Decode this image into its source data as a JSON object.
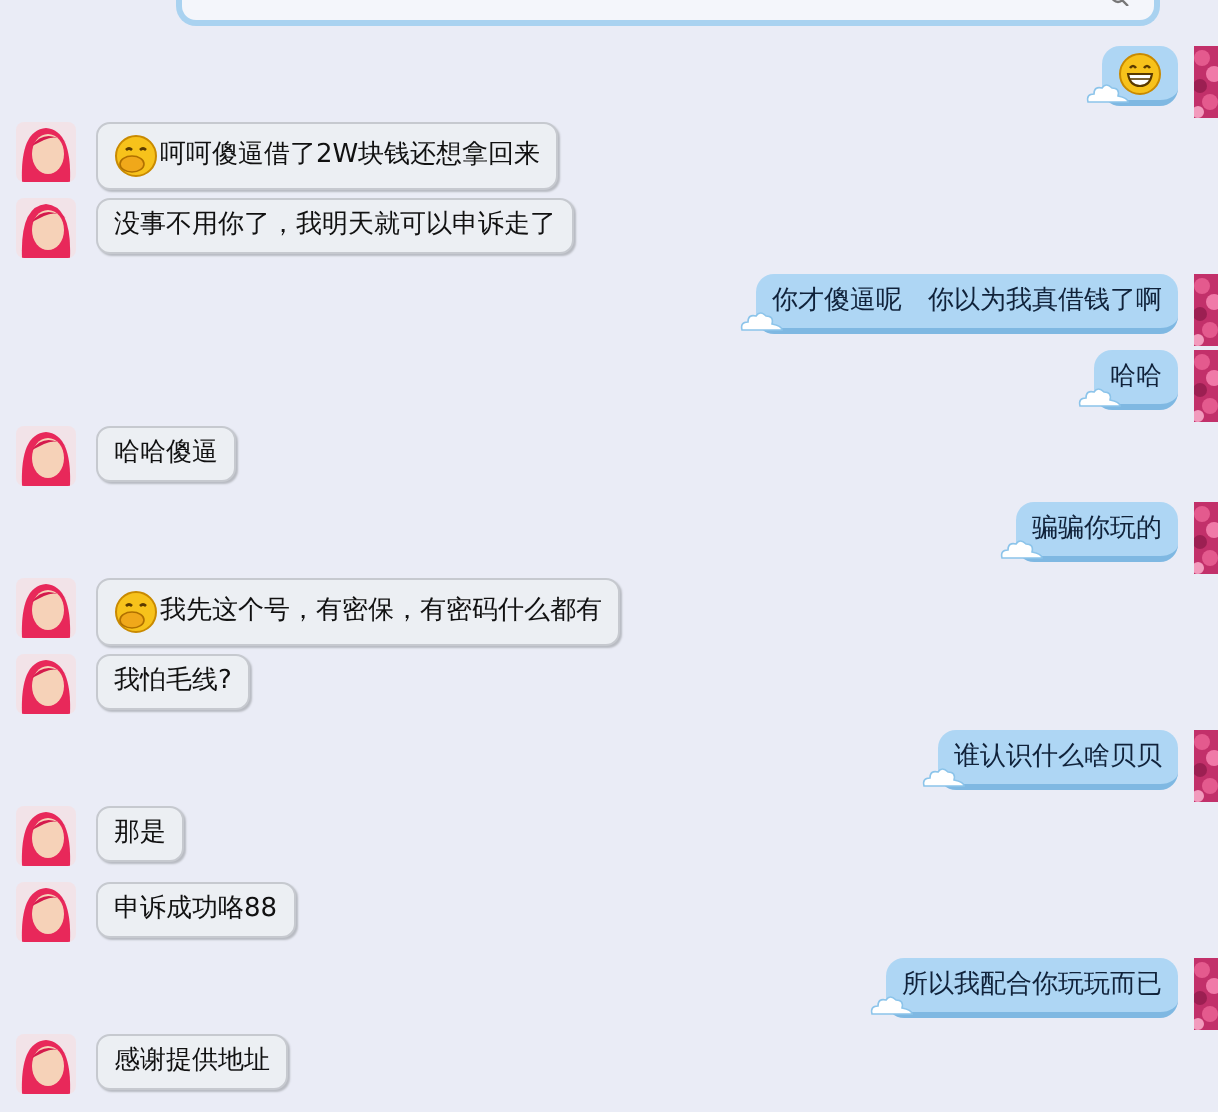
{
  "messages": [
    {
      "kind": "right",
      "emoji": true
    },
    {
      "kind": "left",
      "emoji": true,
      "text": "呵呵傻逼借了2W块钱还想拿回来"
    },
    {
      "kind": "left",
      "emoji": false,
      "text": "没事不用你了，我明天就可以申诉走了"
    },
    {
      "kind": "right",
      "emoji": false,
      "text": "你才傻逼呢　你以为我真借钱了啊"
    },
    {
      "kind": "right",
      "emoji": false,
      "text": "哈哈"
    },
    {
      "kind": "left",
      "emoji": false,
      "text": "哈哈傻逼"
    },
    {
      "kind": "right",
      "emoji": false,
      "text": "骗骗你玩的"
    },
    {
      "kind": "left",
      "emoji": true,
      "text": "我先这个号，有密保，有密码什么都有"
    },
    {
      "kind": "left",
      "emoji": false,
      "text": "我怕毛线?"
    },
    {
      "kind": "right",
      "emoji": false,
      "text": "谁认识什么啥贝贝"
    },
    {
      "kind": "left",
      "emoji": false,
      "text": "那是"
    },
    {
      "kind": "left",
      "emoji": false,
      "text": "申诉成功咯88"
    },
    {
      "kind": "right",
      "emoji": false,
      "text": "所以我配合你玩玩而已"
    },
    {
      "kind": "left",
      "emoji": false,
      "text": "感谢提供地址"
    }
  ]
}
